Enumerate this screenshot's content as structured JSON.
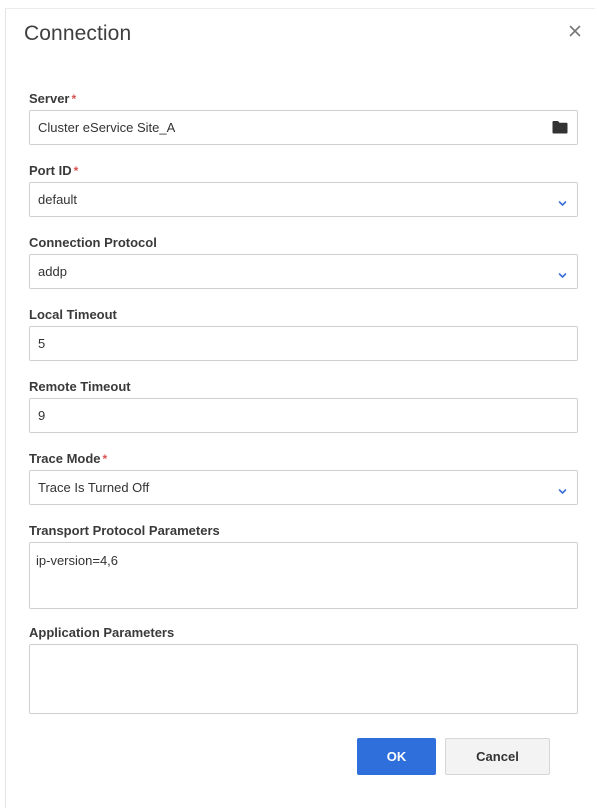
{
  "dialog": {
    "title": "Connection",
    "close_glyph": "×"
  },
  "fields": {
    "server": {
      "label": "Server",
      "required": "*",
      "value": "Cluster eService Site_A",
      "icon": "folder-icon"
    },
    "port_id": {
      "label": "Port ID",
      "required": "*",
      "value": "default"
    },
    "connection_protocol": {
      "label": "Connection Protocol",
      "value": "addp"
    },
    "local_timeout": {
      "label": "Local Timeout",
      "value": "5"
    },
    "remote_timeout": {
      "label": "Remote Timeout",
      "value": "9"
    },
    "trace_mode": {
      "label": "Trace Mode",
      "required": "*",
      "value": "Trace Is Turned Off"
    },
    "transport_protocol_parameters": {
      "label": "Transport Protocol Parameters",
      "value": "ip-version=4,6"
    },
    "application_parameters": {
      "label": "Application Parameters",
      "value": ""
    }
  },
  "buttons": {
    "ok_label": "OK",
    "cancel_label": "Cancel"
  },
  "colors": {
    "primary": "#2f6fdb",
    "required": "#d9534f",
    "chevron": "#3a6fd8"
  }
}
